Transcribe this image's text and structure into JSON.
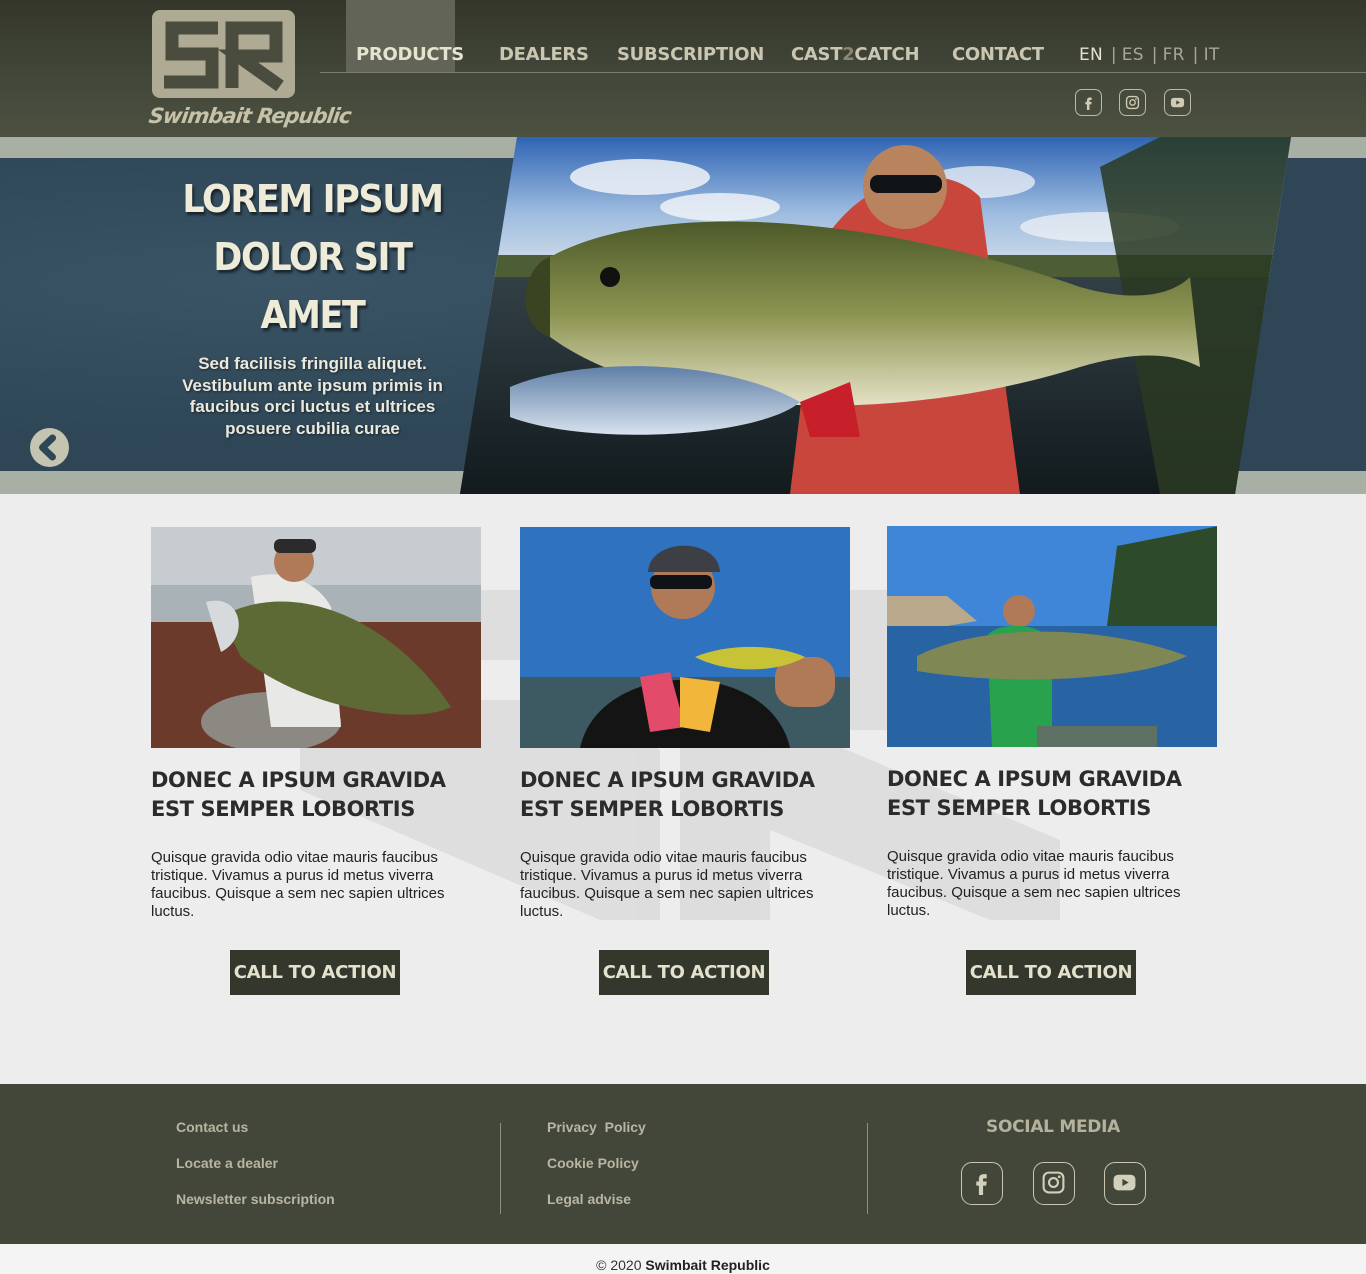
{
  "brand": {
    "name": "Swimbait Republic"
  },
  "nav": {
    "items": [
      {
        "label": "PRODUCTS",
        "active": true
      },
      {
        "label": "DEALERS"
      },
      {
        "label": "SUBSCRIPTION"
      },
      {
        "label_a": "CAST",
        "label_b": "2",
        "label_c": "CATCH"
      },
      {
        "label": "CONTACT"
      }
    ]
  },
  "languages": {
    "items": [
      "EN",
      "ES",
      "FR",
      "IT"
    ],
    "selected": "EN",
    "separator": "|"
  },
  "header_social": [
    "facebook-icon",
    "instagram-icon",
    "youtube-icon"
  ],
  "hero": {
    "title_lines": [
      "LOREM IPSUM",
      "DOLOR SIT",
      "AMET"
    ],
    "subtitle_lines": [
      "Sed facilisis fringilla aliquet.",
      "Vestibulum ante ipsum primis in",
      "faucibus orci luctus et ultrices",
      "posuere cubilia curae"
    ],
    "prev_icon": "chevron-left-icon"
  },
  "cards": [
    {
      "title": "DONEC A IPSUM GRAVIDA EST SEMPER LOBORTIS",
      "text": " Quisque gravida odio vitae mauris faucibus tristique. Vivamus a purus id metus viverra faucibus. Quisque a sem nec sapien ultrices luctus.",
      "cta": "CALL TO ACTION"
    },
    {
      "title": "DONEC A IPSUM GRAVIDA EST SEMPER LOBORTIS",
      "text": " Quisque gravida odio vitae mauris faucibus tristique. Vivamus a purus id metus viverra faucibus. Quisque a sem nec sapien ultrices luctus.",
      "cta": "CALL TO ACTION"
    },
    {
      "title": "DONEC A IPSUM GRAVIDA EST SEMPER LOBORTIS",
      "text": " Quisque gravida odio vitae mauris faucibus tristique. Vivamus a purus id metus viverra faucibus. Quisque a sem nec sapien ultrices luctus.",
      "cta": "CALL TO ACTION"
    }
  ],
  "footer": {
    "col1": [
      "Contact us",
      "Locate a dealer",
      "Newsletter subscription"
    ],
    "col2": [
      "Privacy  Policy",
      "Cookie Policy",
      "Legal advise"
    ],
    "social_title": "SOCIAL MEDIA",
    "social": [
      "facebook-icon",
      "instagram-icon",
      "youtube-icon"
    ]
  },
  "copyright": {
    "prefix": "© 2020",
    "name": "Swimbait Republic"
  },
  "colors": {
    "header": "#43473a",
    "hero_band": "#2e4656",
    "cta": "#33372c",
    "footer": "#43473a"
  }
}
